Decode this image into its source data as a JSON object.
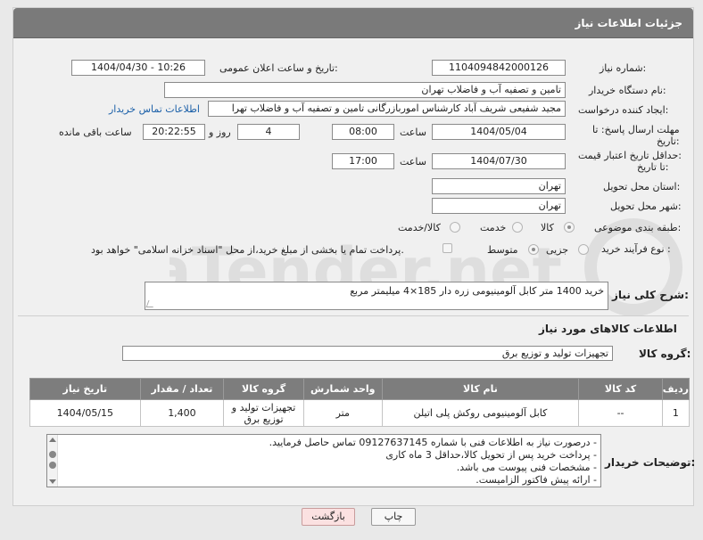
{
  "header": {
    "title": "جزئیات اطلاعات نیاز"
  },
  "fields": {
    "need_number": {
      "label": "شماره نیاز:",
      "value": "1104094842000126"
    },
    "announce_datetime": {
      "label": "تاریخ و ساعت اعلان عمومی:",
      "value": "1404/04/30 - 10:26"
    },
    "buyer_org": {
      "label": "نام دستگاه خریدار:",
      "value": "تامین و تصفیه آب و فاضلاب تهران"
    },
    "requester": {
      "label": "ایجاد کننده درخواست:",
      "value": "مجید شفیعی شریف آباد کارشناس اموربازرگانی تامین و تصفیه آب و فاضلاب تهرا",
      "contact_link": "اطلاعات تماس خریدار"
    },
    "deadline": {
      "label_line1": "مهلت ارسال پاسخ: تا",
      "label_line2": "تاریخ:",
      "date": "1404/05/04",
      "time_label": "ساعت",
      "time": "08:00",
      "days_value": "4",
      "days_label": "روز و",
      "remaining_time": "20:22:55",
      "remaining_label": "ساعت باقی مانده"
    },
    "price_validity": {
      "label_line1": "حداقل تاریخ اعتبار قیمت:",
      "label_line2": "تا تاریخ:",
      "date": "1404/07/30",
      "time_label": "ساعت",
      "time": "17:00"
    },
    "delivery_province": {
      "label": "استان محل تحویل:",
      "value": "تهران"
    },
    "delivery_city": {
      "label": "شهر محل تحویل:",
      "value": "تهران"
    },
    "category": {
      "label": "طبقه بندی موضوعی:",
      "options": [
        "کالا",
        "خدمت",
        "کالا/خدمت"
      ],
      "selected": "کالا"
    },
    "process_type": {
      "label": "نوع فرآیند خرید :",
      "options": [
        "جزیی",
        "متوسط"
      ],
      "selected": "متوسط",
      "treasury_note": "پرداخت تمام یا بخشی از مبلغ خرید،از محل \"اسناد خزانه اسلامی\" خواهد بود."
    }
  },
  "summary": {
    "label": "شرح کلی نیاز:",
    "value": "خرید 1400 متر کابل آلومینیومی زره دار 185×4 میلیمتر مربع"
  },
  "goods_section": {
    "title": "اطلاعات کالاهای مورد نیاز",
    "group_label": "گروه کالا:",
    "group_value": "تجهیزات تولید و توزیع برق"
  },
  "table": {
    "headers": [
      "ردیف",
      "کد کالا",
      "نام کالا",
      "واحد شمارش",
      "گروه کالا",
      "تعداد / مقدار",
      "تاریخ نیاز"
    ],
    "rows": [
      [
        "1",
        "--",
        "کابل آلومینیومی روکش پلی اتیلن",
        "متر",
        "تجهیزات تولید و توزیع برق",
        "1,400",
        "1404/05/15"
      ]
    ]
  },
  "buyer_notes": {
    "label": "توضیحات خریدار:",
    "lines": [
      "- درصورت نیاز به اطلاعات فنی با شماره 09127637145 تماس حاصل فرمایید.",
      "- پرداخت خرید پس از تحویل کالا،حداقل 3 ماه کاری",
      "- مشخصات فنی پیوست می باشد.",
      "- ارائه پیش فاکتور الزامیست."
    ]
  },
  "buttons": {
    "print": "چاپ",
    "back": "بازگشت"
  },
  "watermark": {
    "text": "AriaTender.net"
  },
  "colors": {
    "header_bg": "#7a7a7a",
    "link": "#1a5fa8",
    "back_button": "#fbe1e1"
  }
}
